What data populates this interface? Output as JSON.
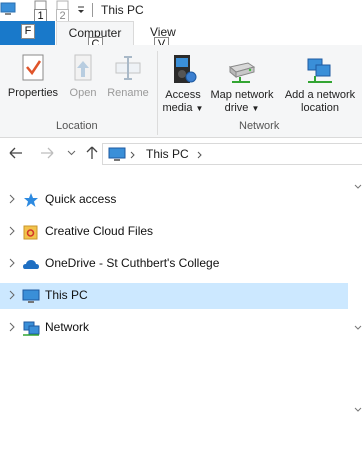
{
  "window": {
    "title": "This PC"
  },
  "quick_access_keytips": [
    "1",
    "2"
  ],
  "ribbon": {
    "file_tab_keytip": "F",
    "tabs": [
      {
        "label": "Computer",
        "keytip": "C",
        "active": true
      },
      {
        "label": "View",
        "keytip": "V",
        "active": false
      }
    ],
    "groups": {
      "location": {
        "label": "Location",
        "buttons": [
          {
            "label": "Properties",
            "enabled": true,
            "icon": "properties-icon"
          },
          {
            "label": "Open",
            "enabled": false,
            "icon": "open-icon"
          },
          {
            "label": "Rename",
            "enabled": false,
            "icon": "rename-icon"
          }
        ]
      },
      "network": {
        "label": "Network",
        "buttons": [
          {
            "line1": "Access",
            "line2": "media",
            "dropdown": true,
            "icon": "access-media-icon"
          },
          {
            "line1": "Map network",
            "line2": "drive",
            "dropdown": true,
            "icon": "map-network-drive-icon"
          },
          {
            "line1": "Add a network",
            "line2": "location",
            "dropdown": false,
            "icon": "add-network-location-icon"
          }
        ]
      }
    }
  },
  "address": {
    "segments": [
      "This PC"
    ],
    "icon": "this-pc-icon"
  },
  "nav_pane": {
    "items": [
      {
        "label": "Quick access",
        "icon": "star-icon",
        "selected": false
      },
      {
        "label": "Creative Cloud Files",
        "icon": "creative-cloud-folder-icon",
        "selected": false
      },
      {
        "label": "OneDrive - St Cuthbert's College",
        "icon": "onedrive-cloud-icon",
        "selected": false
      },
      {
        "label": "This PC",
        "icon": "this-pc-icon",
        "selected": true
      },
      {
        "label": "Network",
        "icon": "network-icon",
        "selected": false
      }
    ]
  },
  "colors": {
    "file_tab": "#1979ca",
    "selection": "#cce8ff",
    "ribbon_bg": "#f5f6f7"
  }
}
